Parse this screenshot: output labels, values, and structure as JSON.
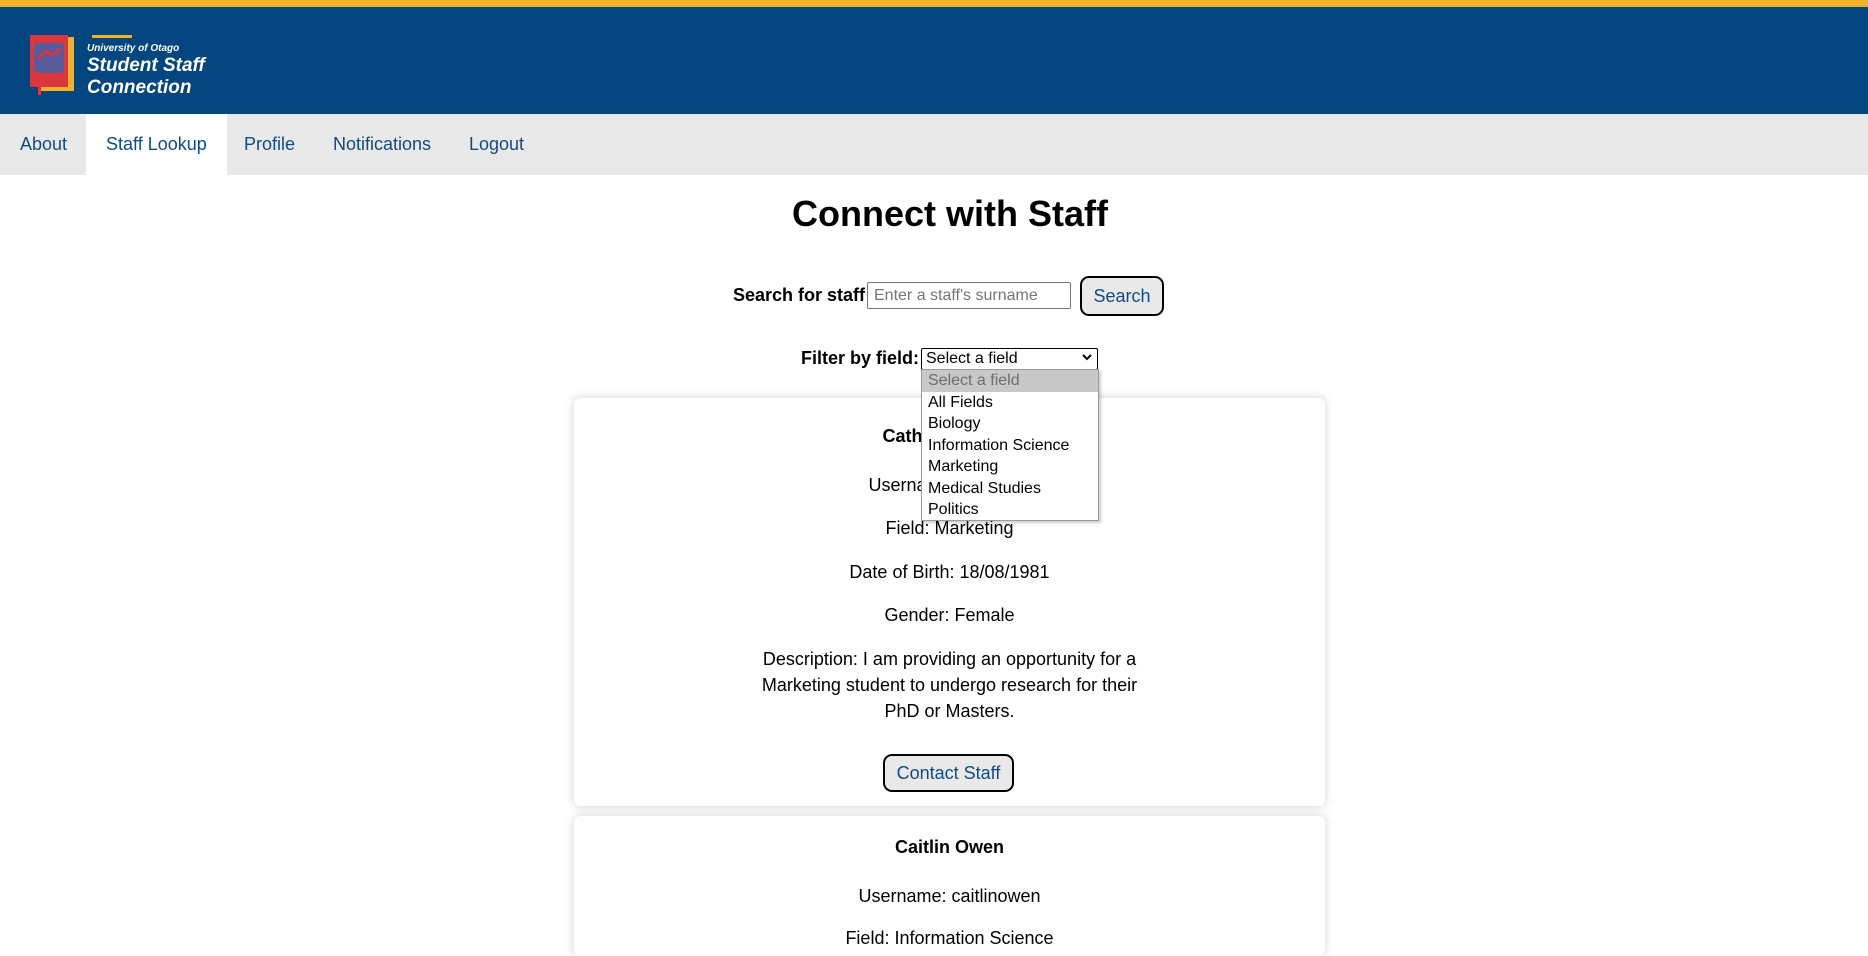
{
  "brand": {
    "university": "University of Otago",
    "app_name_line1": "Student Staff",
    "app_name_line2": "Connection",
    "colors": {
      "header_bg": "#02457f",
      "accent": "#f2b12a",
      "link": "#0e4c86"
    }
  },
  "nav": {
    "items": [
      {
        "label": "About",
        "active": false
      },
      {
        "label": "Staff Lookup",
        "active": true
      },
      {
        "label": "Profile",
        "active": false
      },
      {
        "label": "Notifications",
        "active": false
      },
      {
        "label": "Logout",
        "active": false
      }
    ]
  },
  "page": {
    "title": "Connect with Staff"
  },
  "search": {
    "label": "Search for staff",
    "placeholder": "Enter a staff's surname",
    "value": "",
    "button_label": "Search"
  },
  "filter": {
    "label": "Filter by field:",
    "selected": "Select a field",
    "options": [
      "Select a field",
      "All Fields",
      "Biology",
      "Information Science",
      "Marketing",
      "Medical Studies",
      "Politics"
    ],
    "dropdown_open": true
  },
  "cards": [
    {
      "name": "Cath",
      "username": "Userna",
      "field": "Field: Marketing",
      "dob": "Date of Birth: 18/08/1981",
      "gender": "Gender: Female",
      "description": "Description: I am providing an opportunity for a Marketing student to undergo research for their PhD or Masters.",
      "contact_label": "Contact Staff"
    },
    {
      "name": "Caitlin Owen",
      "username": "Username: caitlinowen",
      "field": "Field: Information Science"
    }
  ]
}
